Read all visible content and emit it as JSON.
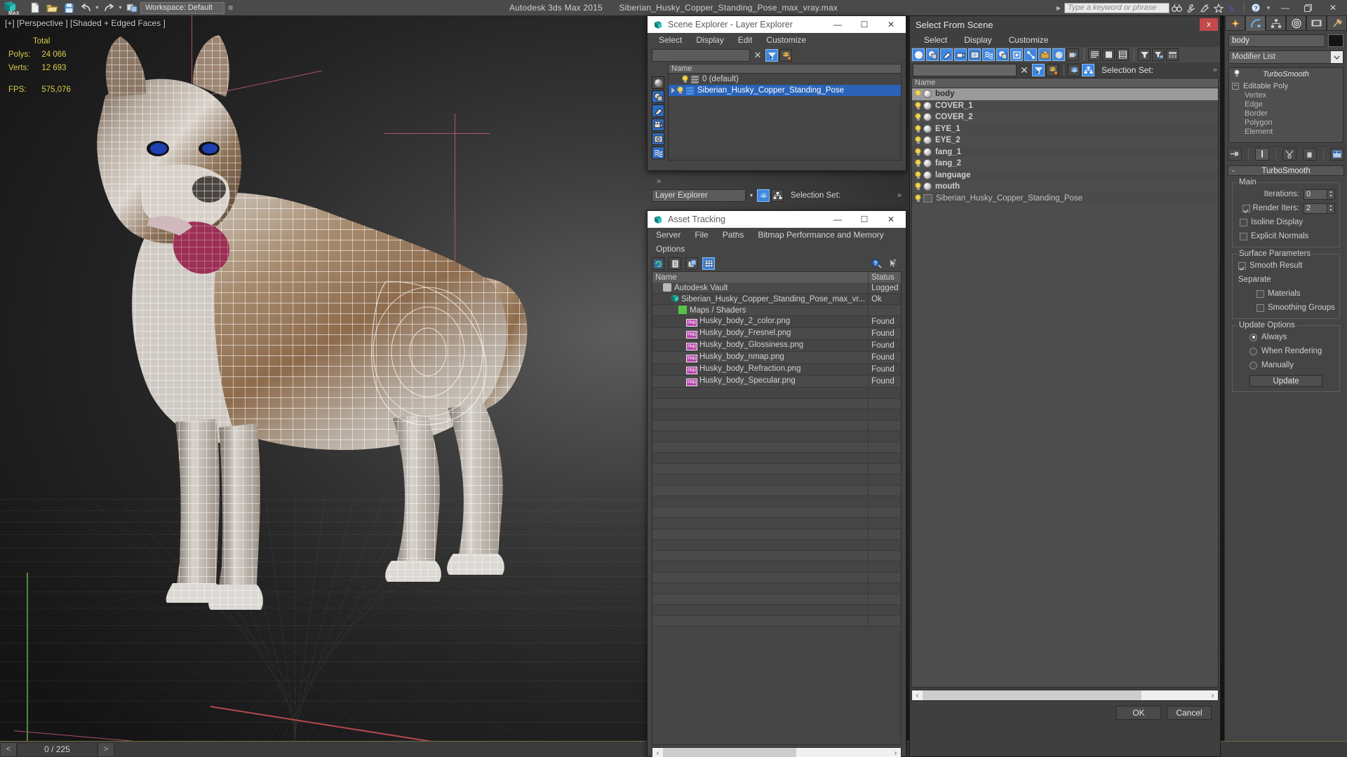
{
  "titlebar": {
    "app_title": "Autodesk 3ds Max  2015",
    "file_name": "Siberian_Husky_Copper_Standing_Pose_max_vray.max",
    "search_placeholder": "Type a keyword or phrase",
    "icons": [
      "binoculars-icon",
      "wrench-icon",
      "satellite-icon",
      "star-icon",
      "exchange-icon",
      "help-icon"
    ],
    "minimize": "—",
    "restore": "❐",
    "close": "✕"
  },
  "maintoolbar": {
    "logo": "3ds-max-logo",
    "buttons": [
      "new-file-icon",
      "open-file-icon",
      "save-file-icon",
      "undo-icon",
      "redo-icon",
      "link-icon"
    ],
    "workspace_label": "Workspace: Default"
  },
  "viewport": {
    "label": "[+] [Perspective ] [Shaded + Edged Faces ]",
    "stats_header": "Total",
    "stats": [
      {
        "label": "Polys:",
        "value": "24 066"
      },
      {
        "label": "Verts:",
        "value": "12 693"
      },
      {
        "label": "FPS:",
        "value": "575,076"
      }
    ],
    "model": "siberian-husky-wireframe"
  },
  "timebar": {
    "prev": "<",
    "frame": "0 / 225",
    "next": ">"
  },
  "scene_explorer": {
    "title": "Scene Explorer - Layer Explorer",
    "icon": "max-window-icon",
    "menus": [
      "Select",
      "Display",
      "Edit",
      "Customize"
    ],
    "search_value": "",
    "clear_icon": "clear-x-icon",
    "toolbar_icons": [
      "filter-icon",
      "layer-filter-icon"
    ],
    "side_icons": [
      "geometry-icon",
      "shapes-icon",
      "lights-icon",
      "cameras-icon",
      "helpers-icon",
      "spacewarps-icon"
    ],
    "overflow": "»",
    "column_header": "Name",
    "rows": [
      {
        "name": "0 (default)",
        "selected": false,
        "expander": false
      },
      {
        "name": "Siberian_Husky_Copper_Standing_Pose",
        "selected": true,
        "expander": true
      }
    ],
    "footer_combo": "Layer Explorer",
    "footer_icons": [
      "layer-mode-icon",
      "hierarchy-mode-icon"
    ],
    "selection_set_label": "Selection Set:"
  },
  "asset_tracking": {
    "title": "Asset Tracking",
    "icon": "max-window-icon",
    "menus": [
      "Server",
      "File",
      "Paths",
      "Bitmap Performance and Memory",
      "Options"
    ],
    "toolbar_icons": [
      "refresh-icon",
      "list-view-icon",
      "path-view-icon",
      "grid-view-icon"
    ],
    "help_icons": [
      "whats-this-icon",
      "help-cursor-icon"
    ],
    "columns": [
      "Name",
      "Status"
    ],
    "rows": [
      {
        "indent": 1,
        "icon": "vault-icon",
        "name": "Autodesk Vault",
        "status": "Logged"
      },
      {
        "indent": 2,
        "icon": "max-file-icon",
        "name": "Siberian_Husky_Copper_Standing_Pose_max_vr...",
        "status": "Ok"
      },
      {
        "indent": 3,
        "icon": "maps-shaders-icon",
        "name": "Maps / Shaders",
        "status": ""
      },
      {
        "indent": 4,
        "icon": "png-icon",
        "name": "Husky_body_2_color.png",
        "status": "Found"
      },
      {
        "indent": 4,
        "icon": "png-icon",
        "name": "Husky_body_Fresnel.png",
        "status": "Found"
      },
      {
        "indent": 4,
        "icon": "png-icon",
        "name": "Husky_body_Glossiness.png",
        "status": "Found"
      },
      {
        "indent": 4,
        "icon": "png-icon",
        "name": "Husky_body_nmap.png",
        "status": "Found"
      },
      {
        "indent": 4,
        "icon": "png-icon",
        "name": "Husky_body_Refraction.png",
        "status": "Found"
      },
      {
        "indent": 4,
        "icon": "png-icon",
        "name": "Husky_body_Specular.png",
        "status": "Found"
      }
    ],
    "empty_row_count": 22,
    "scroll_prev": "‹",
    "scroll_next": "›"
  },
  "select_from_scene": {
    "title": "Select From Scene",
    "close": "x",
    "menus": [
      "Select",
      "Display",
      "Customize"
    ],
    "filter_icons": [
      "geometry-icon",
      "shapes-icon",
      "lights-icon",
      "cameras-icon",
      "helpers-icon",
      "spacewarps-icon",
      "groups-icon",
      "xrefs-icon",
      "bones-icon",
      "containers-icon",
      "particle-icon",
      "freeze-icon"
    ],
    "view_icons": [
      "list-icon",
      "flat-icon",
      "detail-icon"
    ],
    "sort_icons": [
      "filter-icon",
      "filter-settings-icon",
      "column-icon"
    ],
    "search_value": "",
    "clear_icon": "clear-x-icon",
    "row2_icons": [
      "filter-toggle-icon",
      "layer-filter-icon",
      "layer-icon",
      "hierarchy-icon"
    ],
    "selection_set_label": "Selection Set:",
    "overflow": "»",
    "column_header": "Name",
    "rows": [
      {
        "name": "body",
        "selected": true,
        "icon": "sphere-icon"
      },
      {
        "name": "COVER_1",
        "selected": false,
        "icon": "sphere-icon"
      },
      {
        "name": "COVER_2",
        "selected": false,
        "icon": "sphere-icon"
      },
      {
        "name": "EYE_1",
        "selected": false,
        "icon": "sphere-icon"
      },
      {
        "name": "EYE_2",
        "selected": false,
        "icon": "sphere-icon"
      },
      {
        "name": "fang_1",
        "selected": false,
        "icon": "sphere-icon"
      },
      {
        "name": "fang_2",
        "selected": false,
        "icon": "sphere-icon"
      },
      {
        "name": "language",
        "selected": false,
        "icon": "sphere-icon"
      },
      {
        "name": "mouth",
        "selected": false,
        "icon": "sphere-icon"
      },
      {
        "name": "Siberian_Husky_Copper_Standing_Pose",
        "selected": false,
        "icon": "group-icon",
        "plain": true
      }
    ],
    "scroll_prev": "‹",
    "scroll_next": "›",
    "ok_label": "OK",
    "cancel_label": "Cancel"
  },
  "command_panel": {
    "tabs": [
      "create-tab",
      "modify-tab",
      "hierarchy-tab",
      "motion-tab",
      "display-tab",
      "utilities-tab"
    ],
    "active_tab_index": 1,
    "object_name": "body",
    "object_color": "#141414",
    "modifier_list_label": "Modifier List",
    "stack": [
      {
        "label": "TurboSmooth",
        "type": "modifier"
      },
      {
        "label": "Editable Poly",
        "type": "base"
      },
      {
        "label": "Vertex",
        "type": "sub"
      },
      {
        "label": "Edge",
        "type": "sub"
      },
      {
        "label": "Border",
        "type": "sub"
      },
      {
        "label": "Polygon",
        "type": "sub"
      },
      {
        "label": "Element",
        "type": "sub"
      }
    ],
    "stack_buttons": [
      "pin-stack-icon",
      "show-end-result-icon",
      "make-unique-icon",
      "remove-modifier-icon",
      "configure-sets-icon"
    ],
    "rollout": {
      "title": "TurboSmooth",
      "collapse": "-",
      "main_group": "Main",
      "iterations_label": "Iterations:",
      "iterations_value": "0",
      "render_iters_label": "Render Iters:",
      "render_iters_value": "2",
      "render_iters_checked": true,
      "isoline_label": "Isoline Display",
      "isoline_checked": false,
      "explicit_label": "Explicit Normals",
      "explicit_checked": false,
      "surface_group": "Surface Parameters",
      "smooth_result_label": "Smooth Result",
      "smooth_result_checked": true,
      "separate_label": "Separate",
      "materials_label": "Materials",
      "materials_checked": false,
      "smoothing_groups_label": "Smoothing Groups",
      "smoothing_groups_checked": false,
      "update_group": "Update Options",
      "always_label": "Always",
      "when_rendering_label": "When Rendering",
      "manually_label": "Manually",
      "update_selected": "Always",
      "update_button": "Update"
    }
  },
  "colors": {
    "accent_blue": "#2a63b8",
    "icon_blue": "#2f6bbd",
    "panel_bg": "#454545",
    "titlebar_bg": "#4a4a4a",
    "viewport_bg": "#1b1b1b",
    "stat_yellow": "#d8cc4a",
    "close_red": "#c4494b",
    "axis_red": "#b5484e",
    "axis_green": "#4f8b3f",
    "pink_helper": "#c75c7a"
  }
}
